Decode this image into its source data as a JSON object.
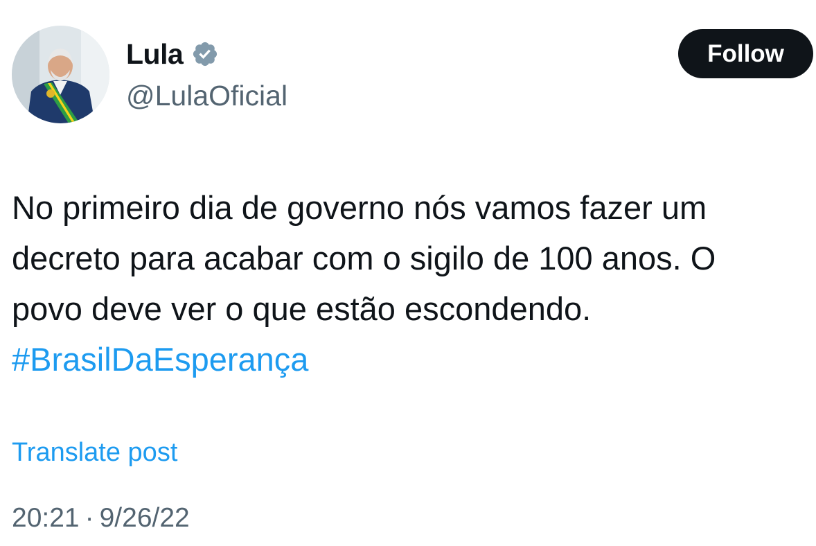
{
  "author": {
    "display_name": "Lula",
    "handle": "@LulaOficial",
    "verified_icon": "verified-badge-icon",
    "verified_color": "#829aab"
  },
  "follow_button": {
    "label": "Follow",
    "background": "#0f1419",
    "text_color": "#ffffff"
  },
  "post": {
    "text_lines": [
      "No primeiro dia de governo nós vamos fazer um",
      "decreto para acabar com o sigilo de 100 anos. O",
      "povo deve ver o que estão escondendo."
    ],
    "hashtag": "#BrasilDaEsperança",
    "link_color": "#1d9bf0"
  },
  "translate_label": "Translate post",
  "meta": {
    "time": "20:21",
    "separator": "·",
    "date": "9/26/22"
  }
}
